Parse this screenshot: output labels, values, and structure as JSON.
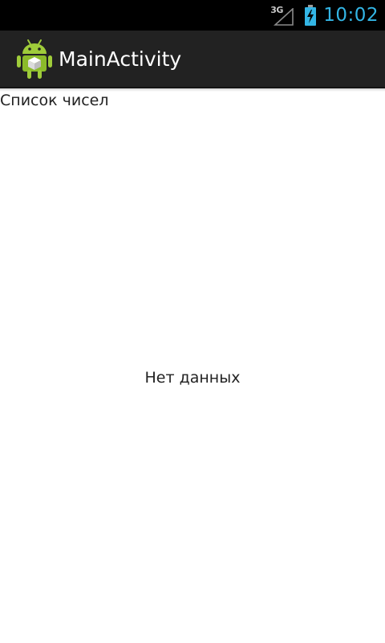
{
  "status_bar": {
    "network_type": "3G",
    "time": "10:02",
    "clock_color": "#33b5e5",
    "icons": [
      "signal-icon",
      "battery-charging-icon"
    ]
  },
  "action_bar": {
    "app_icon": "android-icon",
    "title": "MainActivity",
    "background": "#222222"
  },
  "content": {
    "list_header": "Список чисел",
    "empty_text": "Нет данных"
  }
}
